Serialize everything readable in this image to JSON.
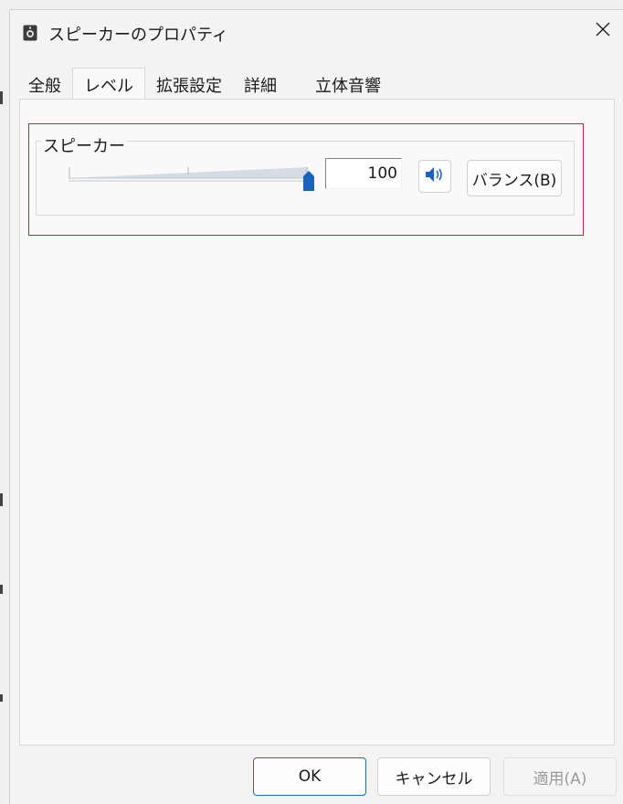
{
  "window": {
    "title": "スピーカーのプロパティ",
    "close_symbol": "✕"
  },
  "tabs": [
    {
      "label": "全般",
      "active": false
    },
    {
      "label": "レベル",
      "active": true
    },
    {
      "label": "拡張設定",
      "active": false
    },
    {
      "label": "詳細",
      "active": false
    },
    {
      "label": "立体音響",
      "active": false
    }
  ],
  "levels": {
    "group_label": "スピーカー",
    "volume_value": "100",
    "volume_level": 1.0,
    "mute_icon": "speaker-volume-icon",
    "balance_label": "バランス(B)"
  },
  "footer": {
    "ok_label": "OK",
    "cancel_label": "キャンセル",
    "apply_label": "適用(A)"
  },
  "colors": {
    "highlight": "#c8203a",
    "accent": "#1f6bb5",
    "thumb": "#1565c0"
  }
}
